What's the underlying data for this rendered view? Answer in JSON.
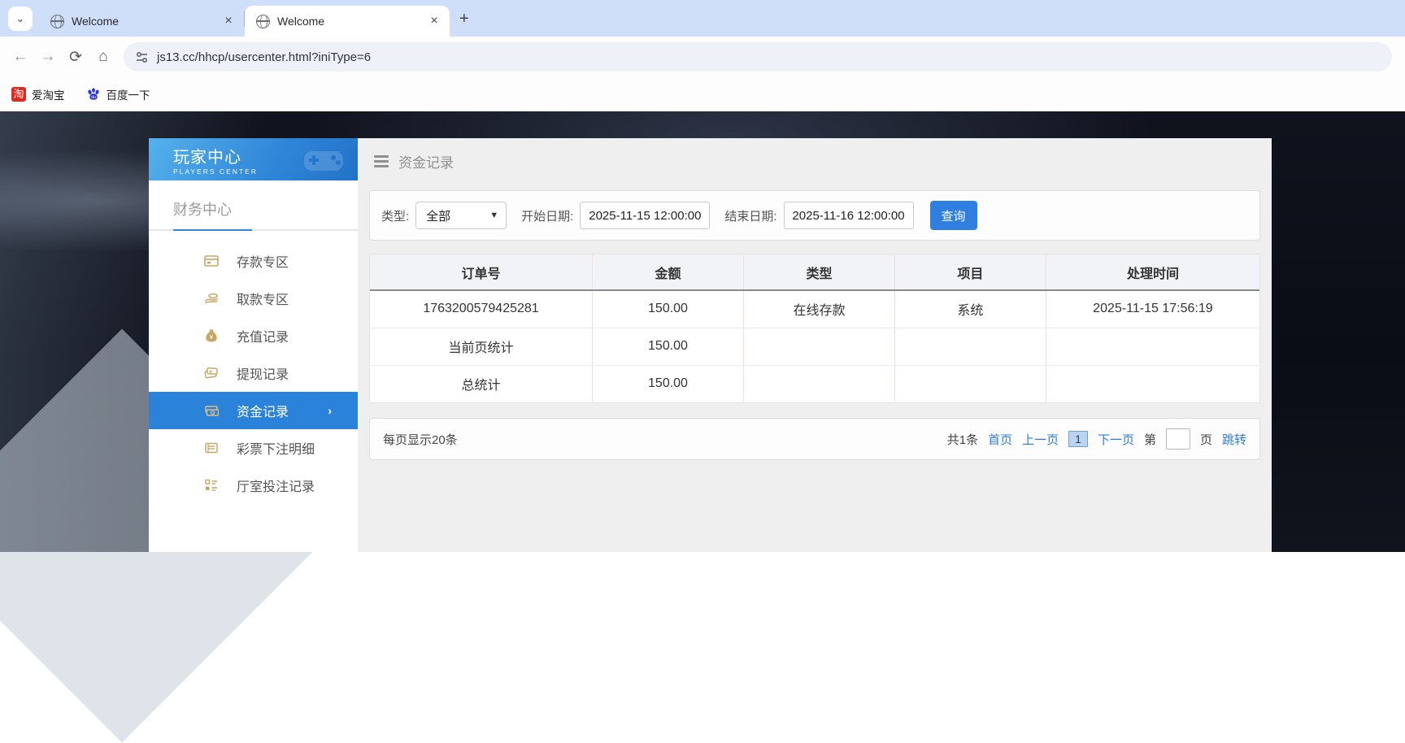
{
  "browser": {
    "tabs": [
      {
        "title": "Welcome"
      },
      {
        "title": "Welcome"
      }
    ],
    "url": "js13.cc/hhcp/usercenter.html?iniType=6",
    "bookmarks": [
      {
        "label": "爱淘宝"
      },
      {
        "label": "百度一下"
      }
    ],
    "taobao_glyph": "淘"
  },
  "sidebar": {
    "title": "玩家中心",
    "subtitle": "PLAYERS CENTER",
    "section": "财务中心",
    "items": [
      {
        "label": "存款专区"
      },
      {
        "label": "取款专区"
      },
      {
        "label": "充值记录"
      },
      {
        "label": "提现记录"
      },
      {
        "label": "资金记录",
        "active": true
      },
      {
        "label": "彩票下注明细"
      },
      {
        "label": "厅室投注记录"
      }
    ],
    "active_chevron": "›"
  },
  "content": {
    "header_title": "资金记录",
    "filters": {
      "type_label": "类型:",
      "type_value": "全部",
      "start_label": "开始日期:",
      "start_value": "2025-11-15 12:00:00",
      "end_label": "结束日期:",
      "end_value": "2025-11-16 12:00:00",
      "search_button": "查询"
    },
    "table": {
      "columns": [
        "订单号",
        "金额",
        "类型",
        "项目",
        "处理时间"
      ],
      "rows": [
        [
          "1763200579425281",
          "150.00",
          "在线存款",
          "系统",
          "2025-11-15 17:56:19"
        ],
        [
          "当前页统计",
          "150.00",
          "",
          "",
          ""
        ],
        [
          "总统计",
          "150.00",
          "",
          "",
          ""
        ]
      ]
    },
    "pagination": {
      "page_size_text": "每页显示20条",
      "total_text": "共1条",
      "first": "首页",
      "prev": "上一页",
      "current_page": "1",
      "next": "下一页",
      "jump_prefix": "第",
      "jump_suffix": "页",
      "jump_action": "跳转"
    }
  },
  "colors": {
    "accent_blue": "#2a82d9",
    "button_blue": "#2e7fe0",
    "link_blue": "#2c7be5",
    "gold_icon": "#c8a766",
    "tabstrip_blue": "#cfdffa"
  }
}
